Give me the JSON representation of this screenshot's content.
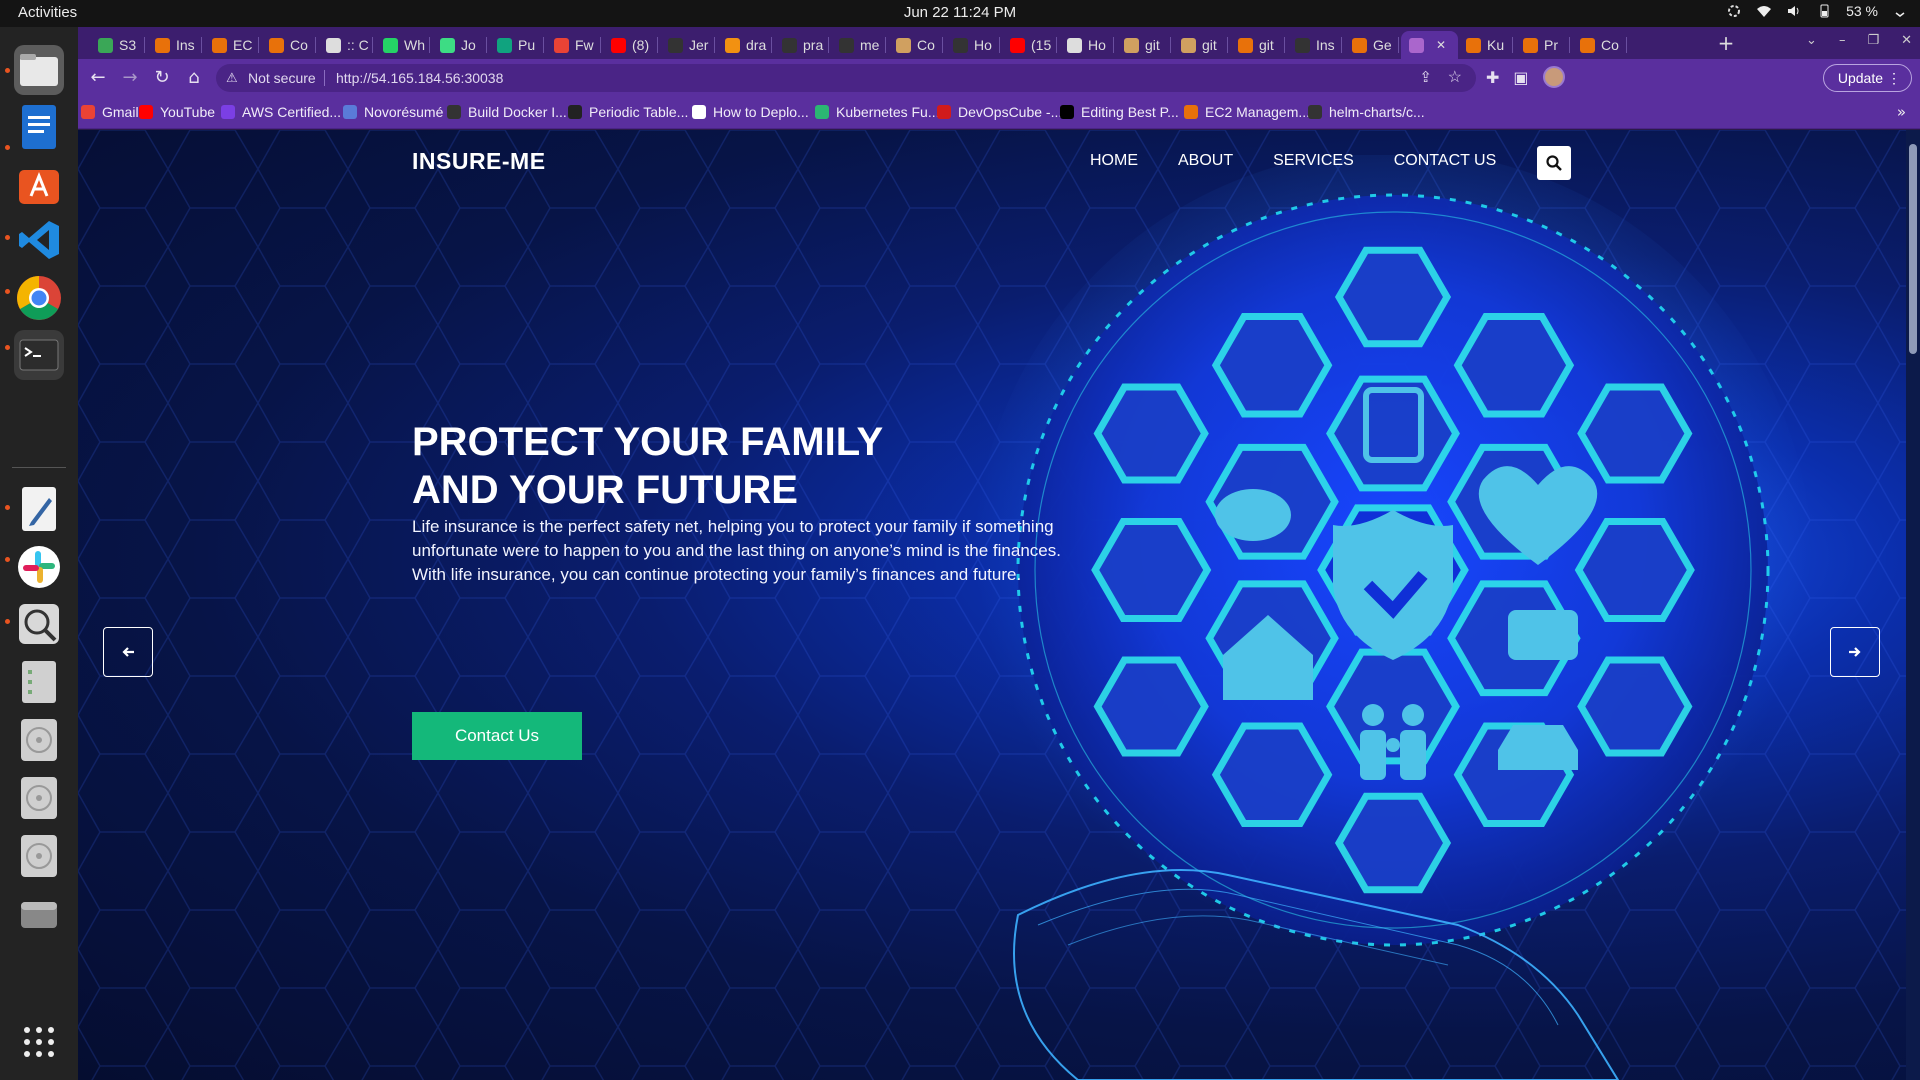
{
  "system": {
    "activities": "Activities",
    "clock": "Jun 22  11:24 PM",
    "battery": "53 %"
  },
  "browser": {
    "tabs": [
      {
        "label": "S3",
        "color": "#3aa757"
      },
      {
        "label": "Ins",
        "color": "#e8710a"
      },
      {
        "label": "EC",
        "color": "#e8710a"
      },
      {
        "label": "Co",
        "color": "#e8710a"
      },
      {
        "label": ":: C",
        "color": "#dddddd"
      },
      {
        "label": "Wh",
        "color": "#25d366"
      },
      {
        "label": "Jo",
        "color": "#3ddc84"
      },
      {
        "label": "Pu",
        "color": "#10a37f"
      },
      {
        "label": "Fw",
        "color": "#ea4335"
      },
      {
        "label": "(8)",
        "color": "#ff0000"
      },
      {
        "label": "Jer",
        "color": "#333333"
      },
      {
        "label": "dra",
        "color": "#f29111"
      },
      {
        "label": "pra",
        "color": "#333333"
      },
      {
        "label": "me",
        "color": "#333333"
      },
      {
        "label": "Co",
        "color": "#d0a060"
      },
      {
        "label": "Ho",
        "color": "#333333"
      },
      {
        "label": "(15",
        "color": "#ff0000"
      },
      {
        "label": "Ho",
        "color": "#dddddd"
      },
      {
        "label": "git",
        "color": "#d0a060"
      },
      {
        "label": "git",
        "color": "#d0a060"
      },
      {
        "label": "git",
        "color": "#e8710a"
      },
      {
        "label": "Ins",
        "color": "#333333"
      },
      {
        "label": "Ge",
        "color": "#e8710a"
      },
      {
        "label": "",
        "color": "#aa66cc",
        "active": true
      },
      {
        "label": "Ku",
        "color": "#e8710a"
      },
      {
        "label": "Pr",
        "color": "#e8710a"
      },
      {
        "label": "Co",
        "color": "#e8710a"
      }
    ],
    "not_secure": "Not secure",
    "url": "http://54.165.184.56:30038",
    "update_label": "Update",
    "bookmarks": [
      {
        "label": "Gmail",
        "color": "#ea4335"
      },
      {
        "label": "YouTube",
        "color": "#ff0000"
      },
      {
        "label": "AWS Certified...",
        "color": "#7b3fe4"
      },
      {
        "label": "Novorésumé",
        "color": "#5a7bd8"
      },
      {
        "label": "Build Docker I...",
        "color": "#333333"
      },
      {
        "label": "Periodic Table...",
        "color": "#222222"
      },
      {
        "label": "How to Deplo...",
        "color": "#ffffff"
      },
      {
        "label": "Kubernetes Fu...",
        "color": "#2bb673"
      },
      {
        "label": "DevOpsCube -...",
        "color": "#d11b1b"
      },
      {
        "label": "Editing Best P...",
        "color": "#000000"
      },
      {
        "label": "EC2 Managem...",
        "color": "#e8710a"
      },
      {
        "label": "helm-charts/c...",
        "color": "#333333"
      }
    ]
  },
  "site": {
    "logo": "INSURE-ME",
    "nav": [
      "HOME",
      "ABOUT",
      "SERVICES",
      "CONTACT US"
    ],
    "hero_title": "PROTECT YOUR FAMILY AND YOUR FUTURE",
    "hero_text": "Life insurance is the perfect safety net, helping you to protect your family if something unfortunate were to happen to you and the last thing on anyone’s mind is the finances. With life insurance, you can continue protecting your family’s finances and future.",
    "cta": "Contact Us"
  }
}
